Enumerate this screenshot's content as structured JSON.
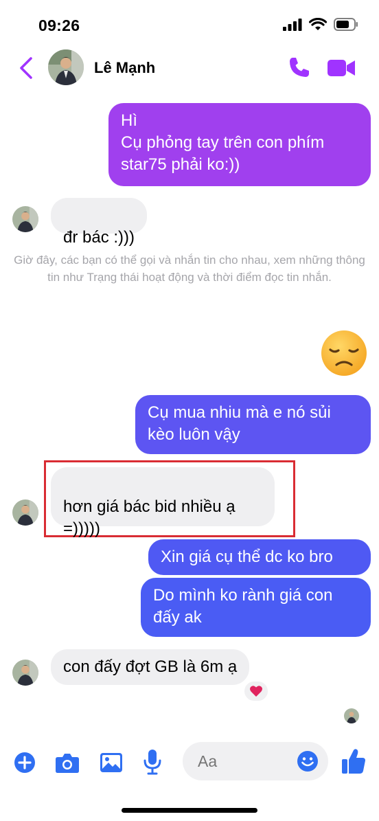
{
  "status_bar": {
    "time": "09:26"
  },
  "header": {
    "contact_name": "Lê Mạnh"
  },
  "messages": [
    {
      "id": "m1",
      "direction": "out",
      "text": "Hì\nCụ phỏng tay trên con phím\nstar75 phải ko:))"
    },
    {
      "id": "m2",
      "direction": "in",
      "text": "đr bác :)))"
    },
    {
      "id": "m3",
      "direction": "out",
      "text": "Cụ mua nhiu mà e nó sủi\nkèo luôn vậy"
    },
    {
      "id": "m4",
      "direction": "in",
      "text": "hơn giá bác bid nhiều ạ\n=)))))"
    },
    {
      "id": "m5",
      "direction": "out",
      "text": "Xin giá cụ thể dc ko bro"
    },
    {
      "id": "m6",
      "direction": "out",
      "text": "Do mình ko rành giá con\nđấy ak"
    },
    {
      "id": "m7",
      "direction": "in",
      "text": "con đấy đợt GB là 6m ạ",
      "reaction": "heart"
    }
  ],
  "system_note": "Giờ đây, các bạn có thể gọi và nhắn tin cho nhau, xem những thông tin như Trạng thái hoạt động và thời điểm đọc tin nhắn.",
  "composer": {
    "placeholder": "Aa"
  },
  "icons": {
    "header": [
      "back-icon",
      "phone-icon",
      "video-camera-icon"
    ],
    "composer": [
      "plus-icon",
      "camera-icon",
      "image-icon",
      "microphone-icon",
      "emoji-icon",
      "thumbs-up-icon"
    ],
    "sent_emoji": "disappointed-face-emoji",
    "reaction": "heart"
  },
  "colors": {
    "accent": "#a033ff",
    "out_bubble_top": "#a040ee",
    "out_bubble_bottom": "#4a5cf4",
    "in_bubble": "#efeff1",
    "highlight": "#d92c33",
    "composer_icon": "#2f6ff2"
  }
}
